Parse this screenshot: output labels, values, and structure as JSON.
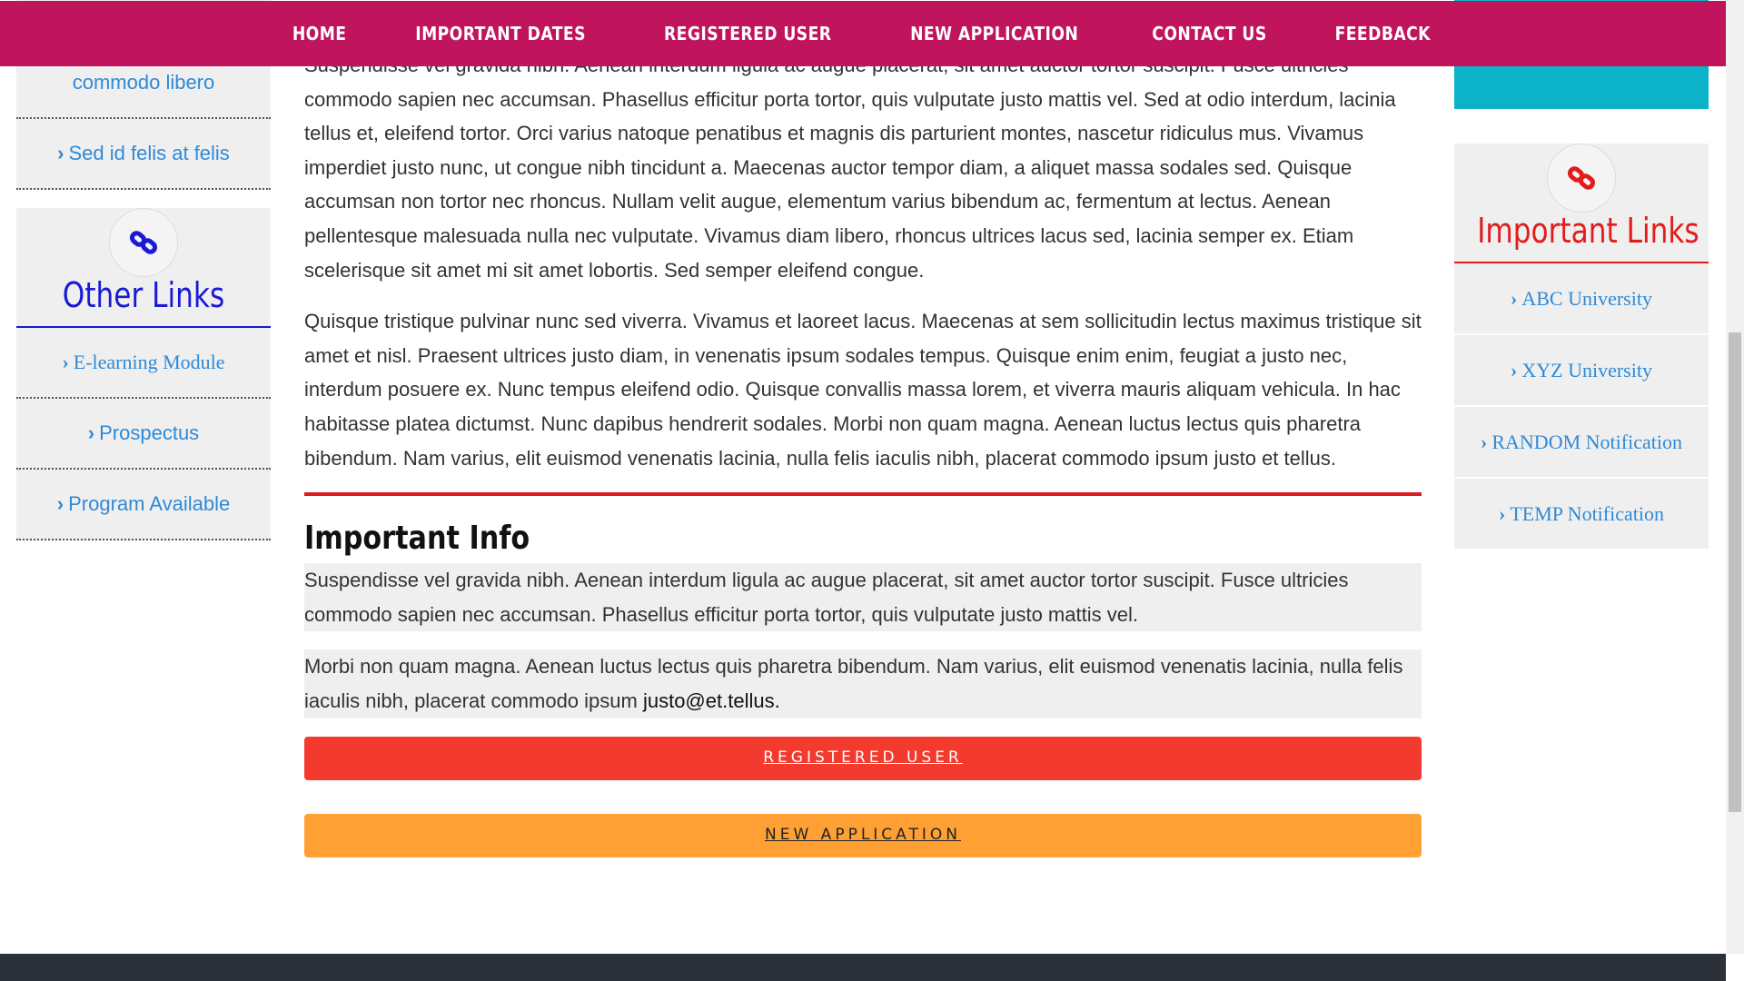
{
  "nav": {
    "items": [
      "HOME",
      "IMPORTANT DATES",
      "REGISTERED USER",
      "NEW APPLICATION",
      "CONTACT US",
      "FEEDBACK"
    ]
  },
  "left_sidebar": {
    "top_links": [
      "commodo libero",
      "Sed id felis at felis"
    ],
    "other_links": {
      "title": "Other Links",
      "icon": "link-icon",
      "items": [
        "E-learning Module",
        "Prospectus",
        "Program Available"
      ]
    }
  },
  "main": {
    "para1": "Suspendisse vel gravida nibh. Aenean interdum ligula ac augue placerat, sit amet auctor tortor suscipit. Fusce ultricies commodo sapien nec accumsan. Phasellus efficitur porta tortor, quis vulputate justo mattis vel. Sed at odio interdum, lacinia tellus et, eleifend tortor. Orci varius natoque penatibus et magnis dis parturient montes, nascetur ridiculus mus. Vivamus imperdiet justo nunc, ut congue nibh tincidunt a. Maecenas auctor tempor diam, a aliquet massa sodales sed. Quisque accumsan non tortor nec rhoncus. Nullam velit augue, elementum varius bibendum ac, fermentum at lectus. Aenean pellentesque malesuada nulla nec vulputate. Vivamus diam libero, rhoncus ultrices lacus sed, lacinia semper ex. Etiam scelerisque sit amet mi sit amet lobortis. Sed semper eleifend congue.",
    "para2": "Quisque tristique pulvinar nunc sed viverra. Vivamus et laoreet lacus. Maecenas at sem sollicitudin lectus maximus tristique sit amet et nisl. Praesent ultrices justo diam, in venenatis ipsum sodales tempus. Quisque enim enim, feugiat a justo nec, interdum posuere ex. Nunc tempus eleifend odio. Quisque convallis massa lorem, et viverra mauris aliquam vehicula. In hac habitasse platea dictumst. Nunc dapibus hendrerit sodales. Morbi non quam magna. Aenean luctus lectus quis pharetra bibendum. Nam varius, elit euismod venenatis lacinia, nulla felis iaculis nibh, placerat commodo ipsum justo et tellus.",
    "info_title": "Important Info",
    "info1": "Suspendisse vel gravida nibh. Aenean interdum ligula ac augue placerat, sit amet auctor tortor suscipit. Fusce ultricies commodo sapien nec accumsan. Phasellus efficitur porta tortor, quis vulputate justo mattis vel.",
    "info2": "Morbi non quam magna. Aenean luctus lectus quis pharetra bibendum. Nam varius, elit euismod venenatis lacinia, nulla felis iaculis nibh, placerat commodo ipsum ",
    "info2_email": "justo@et.tellus.",
    "btn_registered": "REGISTERED USER",
    "btn_new": "NEW APPLICATION"
  },
  "right_sidebar": {
    "important_links": {
      "title": "Important Links",
      "icon": "link-icon",
      "items": [
        "ABC University",
        "XYZ University",
        "RANDOM Notification",
        "TEMP Notification"
      ]
    }
  },
  "colors": {
    "nav_bg": "#c0145c",
    "left_title": "#1a1ad6",
    "right_title": "#e31b1b",
    "link": "#2f8ad6",
    "teal_box": "#0cb3c8",
    "btn_red": "#f23a2e",
    "btn_orange": "#ffa034"
  }
}
